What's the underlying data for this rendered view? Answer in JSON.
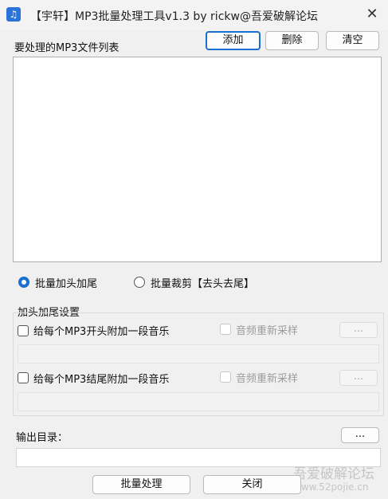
{
  "window": {
    "title": "【宇轩】MP3批量处理工具v1.3  by rickw@吾爱破解论坛",
    "close_glyph": "✕",
    "app_icon_glyph": "♫"
  },
  "file_list": {
    "label": "要处理的MP3文件列表",
    "items": []
  },
  "toolbar": {
    "add_label": "添加",
    "delete_label": "删除",
    "clear_label": "清空"
  },
  "mode": {
    "options": [
      {
        "label": "批量加头加尾",
        "selected": true
      },
      {
        "label": "批量裁剪【去头去尾】",
        "selected": false
      }
    ]
  },
  "head_tail": {
    "group_label": "加头加尾设置",
    "head": {
      "label": "给每个MP3开头附加一段音乐",
      "checked": false,
      "resample_label": "音频重新采样",
      "browse_label": "...",
      "path_value": ""
    },
    "tail": {
      "label": "给每个MP3结尾附加一段音乐",
      "checked": false,
      "resample_label": "音频重新采样",
      "browse_label": "...",
      "path_value": ""
    }
  },
  "output": {
    "label": "输出目录：",
    "browse_label": "...",
    "path_value": ""
  },
  "actions": {
    "process_label": "批量处理",
    "close_label": "关闭"
  },
  "watermark": {
    "line1": "吾爱破解论坛",
    "line2": "www.52pojie.cn"
  },
  "colors": {
    "accent": "#1a6fd0",
    "background": "#f0f0f0"
  }
}
